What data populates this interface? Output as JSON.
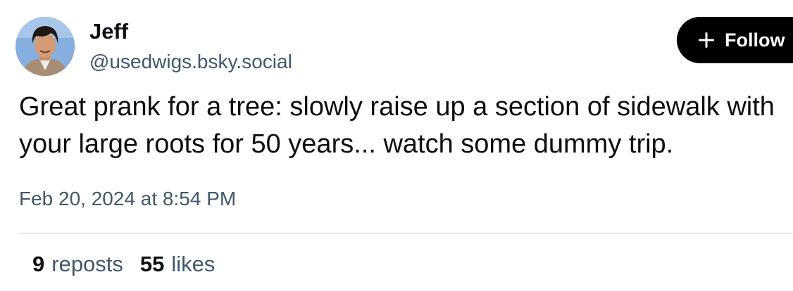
{
  "author": {
    "display_name": "Jeff",
    "handle": "@usedwigs.bsky.social"
  },
  "follow_button": {
    "label": "Follow",
    "icon": "plus-icon"
  },
  "post": {
    "text": "Great prank for a tree: slowly raise up a section of sidewalk with your large roots for 50 years... watch some dummy trip.",
    "timestamp": "Feb 20, 2024 at 8:54 PM"
  },
  "stats": {
    "reposts_count": "9",
    "reposts_label": "reposts",
    "likes_count": "55",
    "likes_label": "likes"
  },
  "colors": {
    "text_primary": "#0b0f14",
    "text_secondary": "#42576c",
    "button_bg": "#000000",
    "divider": "#e6eaee"
  }
}
